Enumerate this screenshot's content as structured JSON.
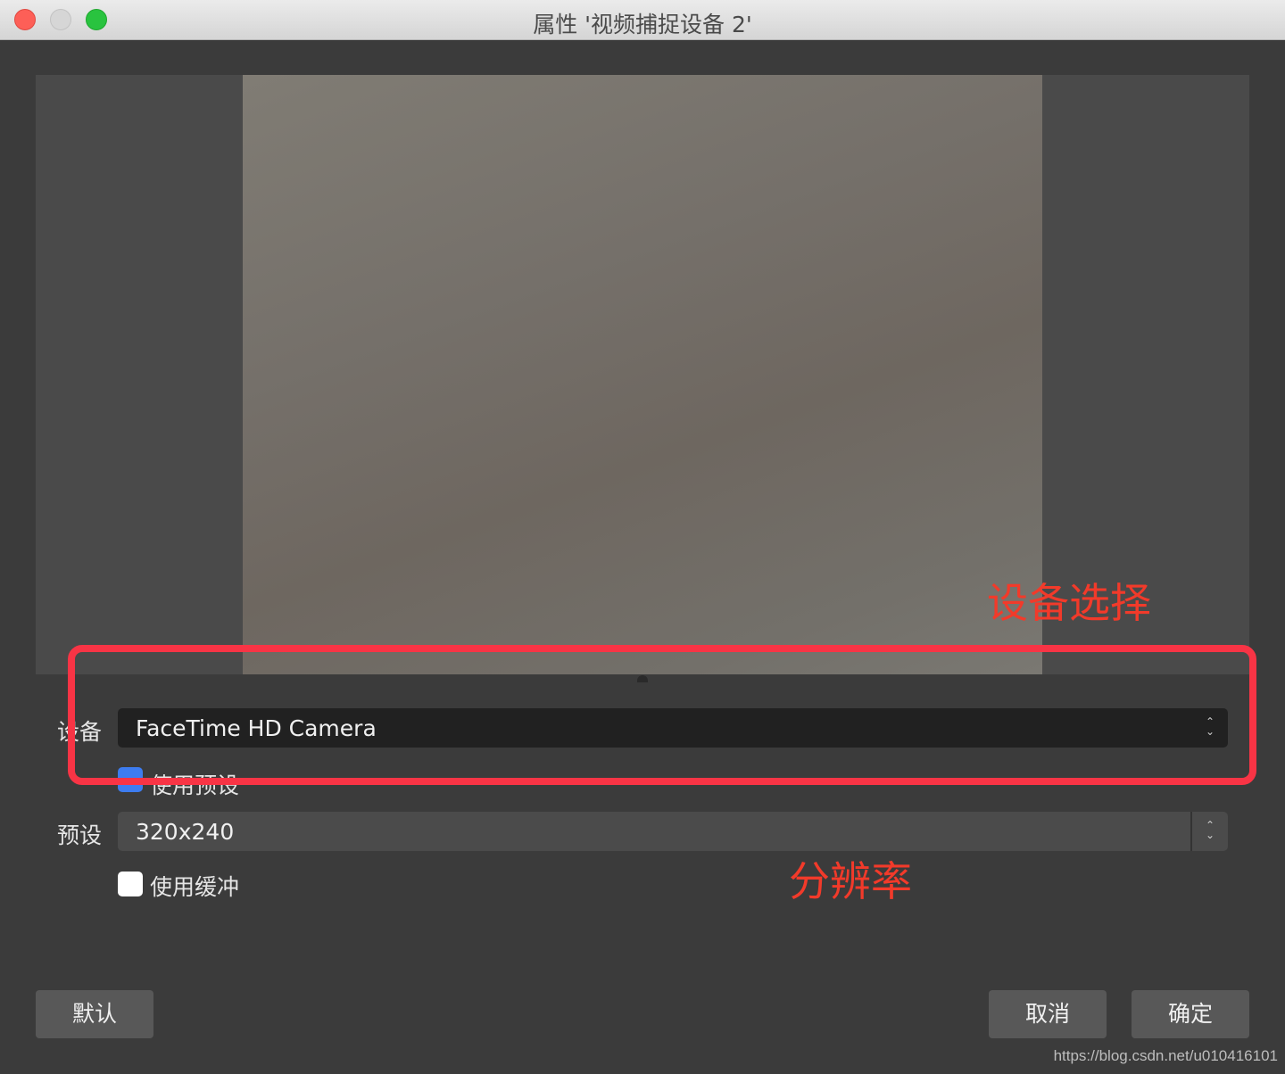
{
  "window": {
    "title": "属性 '视频捕捉设备 2'"
  },
  "form": {
    "device_label": "设备",
    "device_value": "FaceTime HD Camera",
    "use_preset_label": "使用预设",
    "use_preset_checked": true,
    "preset_label": "预设",
    "preset_value": "320x240",
    "use_buffer_label": "使用缓冲",
    "use_buffer_checked": false
  },
  "annotations": {
    "device_select": "设备选择",
    "resolution": "分辨率",
    "color": "#f83445"
  },
  "buttons": {
    "default": "默认",
    "cancel": "取消",
    "ok": "确定"
  },
  "watermark": "https://blog.csdn.net/u010416101",
  "colors": {
    "background": "#3b3b3b",
    "checkbox_checked": "#3d7cf0",
    "select_dark": "#212121"
  }
}
